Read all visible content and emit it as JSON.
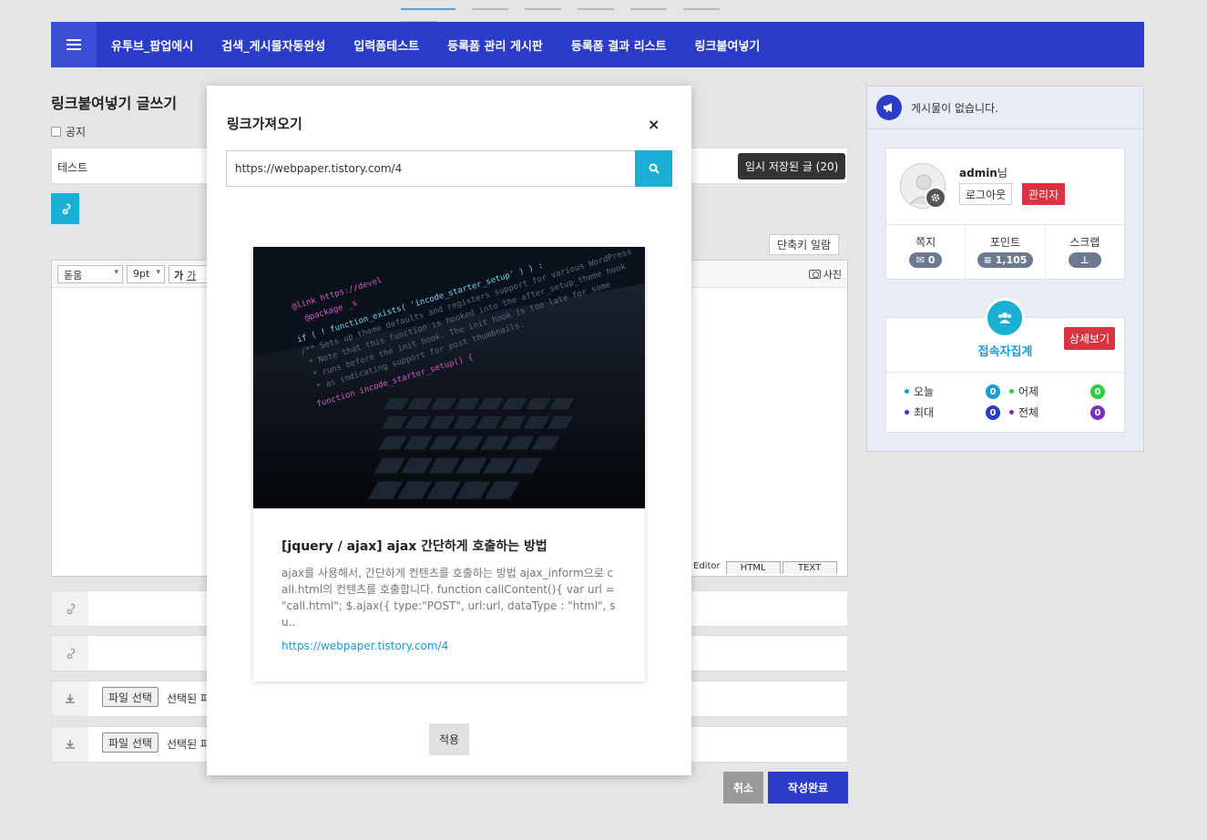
{
  "nav": {
    "items": [
      "유투브_팝업에시",
      "검색_게시물자동완성",
      "입력폼테스트",
      "등록폼 관리 게시판",
      "등록폼 결과 리스트",
      "링크붙여넣기"
    ]
  },
  "form": {
    "page_title": "링크붙여넣기 글쓰기",
    "notice_label": "공지",
    "subject_value": "테스트",
    "draft_button": "임시 저장된 글 (20)",
    "hotkey_button": "단축키 일람",
    "editor": {
      "font_select": "돋움",
      "size_select": "9pt",
      "bold_label": "가",
      "italic_label": "가",
      "photo_label": "사진",
      "mode_editor": "Editor",
      "mode_html": "HTML",
      "mode_text": "TEXT"
    },
    "file_button": "파일 선택",
    "file_status": "선택된 파",
    "cancel_button": "취소",
    "submit_button": "작성완료"
  },
  "sidebar": {
    "latest_text": "게시물이 없습니다.",
    "profile": {
      "username": "admin",
      "suffix": "님",
      "logout": "로그아웃",
      "admin": "관리자",
      "stats": [
        {
          "label": "쪽지",
          "value": "0"
        },
        {
          "label": "포인트",
          "value": "1,105"
        },
        {
          "label": "스크랩",
          "value": ""
        }
      ]
    },
    "visitor": {
      "title": "접속자집계",
      "detail": "상세보기",
      "rows": [
        {
          "label": "오늘",
          "value": "0",
          "dot": "#1a9bd7",
          "badge": "#1a9bd7"
        },
        {
          "label": "어제",
          "value": "0",
          "dot": "#2ecc40",
          "badge": "#2ecc40"
        },
        {
          "label": "최대",
          "value": "0",
          "dot": "#2a3cc8",
          "badge": "#2a3cc8"
        },
        {
          "label": "전체",
          "value": "0",
          "dot": "#7b2fbf",
          "badge": "#7b2fbf"
        }
      ]
    }
  },
  "modal": {
    "title": "링크가져오기",
    "close": "×",
    "url_value": "https://webpaper.tistory.com/4",
    "card": {
      "title": "[jquery / ajax] ajax 간단하게 호출하는 방법",
      "description": "ajax를 사용해서, 간단하게 컨텐츠를 호출하는 방법 ajax_inform으로 call.html의 컨텐츠를 호출합니다. function callContent(){ var url = \"call.html\"; $.ajax({ type:\"POST\", url:url, dataType : \"html\", su..",
      "url": "https://webpaper.tistory.com/4",
      "image_code": [
        "@link https://devel",
        "@package _s",
        "if ( ! function_exists( 'incode_starter_setup' ) ) :",
        "/** Sets up theme defaults and registers support for various WordPress",
        "* Note that this function is hooked into the after_setup_theme hook",
        "* runs before the init hook. The init hook is too late for some",
        "* as indicating support for post thumbnails.",
        "function incode_starter_setup() {"
      ]
    },
    "apply": "적용"
  }
}
